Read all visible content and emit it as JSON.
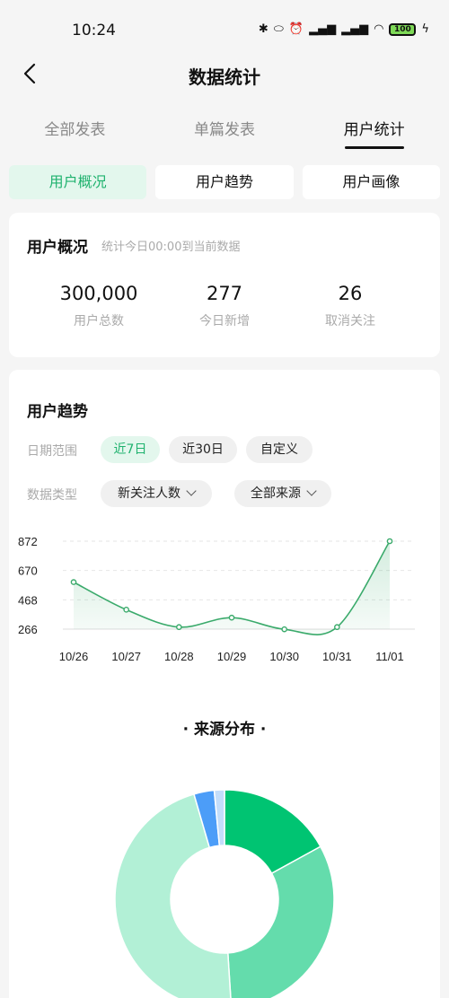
{
  "status_bar": {
    "time": "10:24",
    "battery": "100",
    "icons": [
      "bluetooth-icon",
      "nfc-icon",
      "alarm-icon",
      "signal-icon",
      "signal-icon",
      "wifi-icon",
      "battery-icon",
      "charging-icon"
    ]
  },
  "header": {
    "title": "数据统计"
  },
  "tabs": [
    {
      "label": "全部发表"
    },
    {
      "label": "单篇发表"
    },
    {
      "label": "用户统计",
      "active": true
    }
  ],
  "subtabs": [
    {
      "label": "用户概况",
      "active": true
    },
    {
      "label": "用户趋势"
    },
    {
      "label": "用户画像"
    }
  ],
  "overview": {
    "title": "用户概况",
    "subtitle": "统计今日00:00到当前数据",
    "stats": [
      {
        "value": "300,000",
        "label": "用户总数"
      },
      {
        "value": "277",
        "label": "今日新增"
      },
      {
        "value": "26",
        "label": "取消关注"
      }
    ]
  },
  "trend": {
    "title": "用户趋势",
    "date_range_label": "日期范围",
    "date_options": [
      {
        "label": "近7日",
        "active": true
      },
      {
        "label": "近30日"
      },
      {
        "label": "自定义"
      }
    ],
    "data_type_label": "数据类型",
    "data_type_value": "新关注人数",
    "source_value": "全部来源"
  },
  "colors": {
    "accent": "#1fb26e",
    "line": "#3aaa6b",
    "pie": [
      "#00c472",
      "#64dcac",
      "#b2f0d6",
      "#4c9df8",
      "#c3ddfa"
    ]
  },
  "chart_data": [
    {
      "type": "line",
      "x": [
        "10/26",
        "10/27",
        "10/28",
        "10/29",
        "10/30",
        "10/31",
        "11/01"
      ],
      "series": [
        {
          "values": [
            590,
            400,
            280,
            345,
            265,
            280,
            872
          ]
        }
      ],
      "yticks": [
        266,
        468,
        670,
        872
      ],
      "ylim": [
        266,
        872
      ],
      "grid": true
    },
    {
      "type": "pie",
      "title": "来源分布",
      "values": [
        17,
        32,
        46.5,
        3,
        1.5
      ],
      "donut": true
    }
  ]
}
